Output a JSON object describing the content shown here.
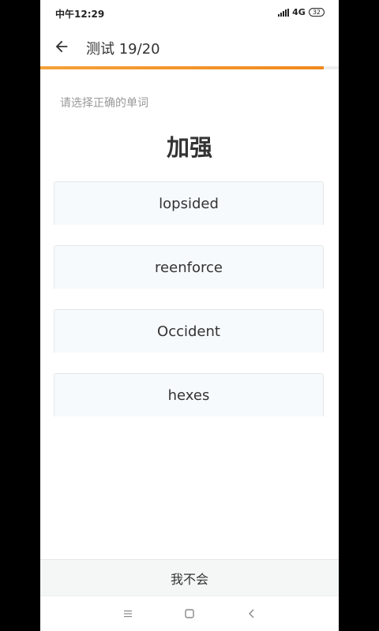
{
  "status_bar": {
    "time": "中午12:29",
    "network": "4G",
    "battery": "32"
  },
  "header": {
    "title": "测试  19/20",
    "back_icon": "arrow-left-icon"
  },
  "progress": {
    "current": 19,
    "total": 20,
    "fraction": 0.95,
    "color": "#f29a28"
  },
  "quiz": {
    "prompt": "请选择正确的单词",
    "word": "加强",
    "options": [
      "lopsided",
      "reenforce",
      "Occident",
      "hexes"
    ]
  },
  "footer": {
    "dont_know_label": "我不会"
  },
  "nav": {
    "icons": [
      "menu-icon",
      "home-square-icon",
      "back-triangle-icon"
    ]
  }
}
